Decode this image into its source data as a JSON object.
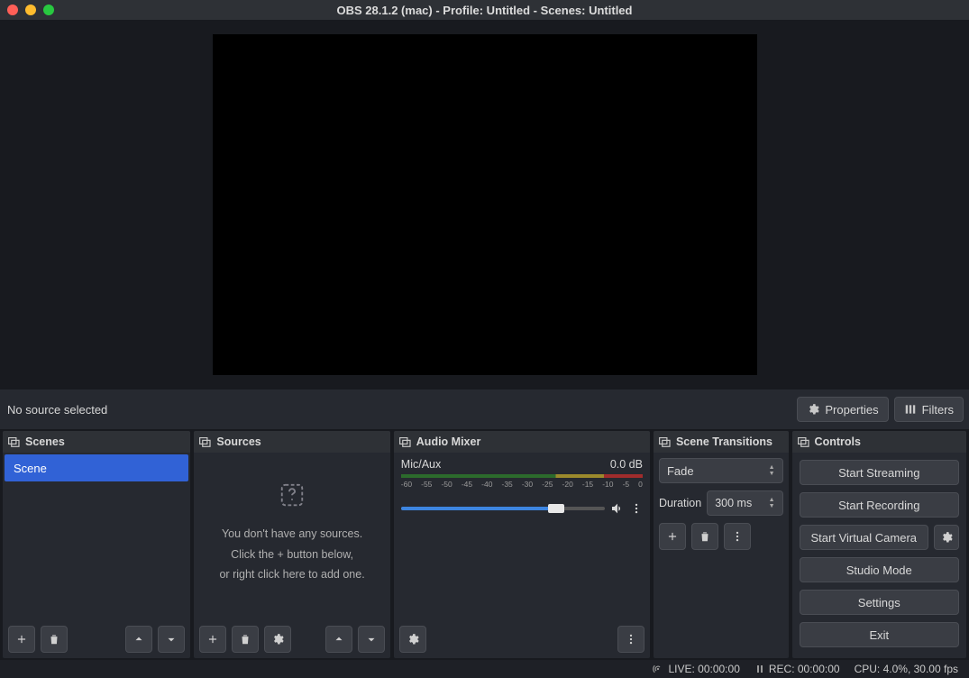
{
  "title": "OBS 28.1.2 (mac) - Profile: Untitled - Scenes: Untitled",
  "src_toolbar": {
    "label": "No source selected",
    "properties": "Properties",
    "filters": "Filters"
  },
  "scenes": {
    "title": "Scenes",
    "items": [
      "Scene"
    ]
  },
  "sources": {
    "title": "Sources",
    "empty1": "You don't have any sources.",
    "empty2": "Click the + button below,",
    "empty3": "or right click here to add one."
  },
  "mixer": {
    "title": "Audio Mixer",
    "channel": "Mic/Aux",
    "level": "0.0 dB",
    "scale": [
      "-60",
      "-55",
      "-50",
      "-45",
      "-40",
      "-35",
      "-30",
      "-25",
      "-20",
      "-15",
      "-10",
      "-5",
      "0"
    ]
  },
  "transitions": {
    "title": "Scene Transitions",
    "selected": "Fade",
    "duration_label": "Duration",
    "duration_value": "300 ms"
  },
  "controls": {
    "title": "Controls",
    "start_streaming": "Start Streaming",
    "start_recording": "Start Recording",
    "start_virtual_camera": "Start Virtual Camera",
    "studio_mode": "Studio Mode",
    "settings": "Settings",
    "exit": "Exit"
  },
  "status": {
    "live": "LIVE: 00:00:00",
    "rec": "REC: 00:00:00",
    "cpu": "CPU: 4.0%, 30.00 fps"
  }
}
